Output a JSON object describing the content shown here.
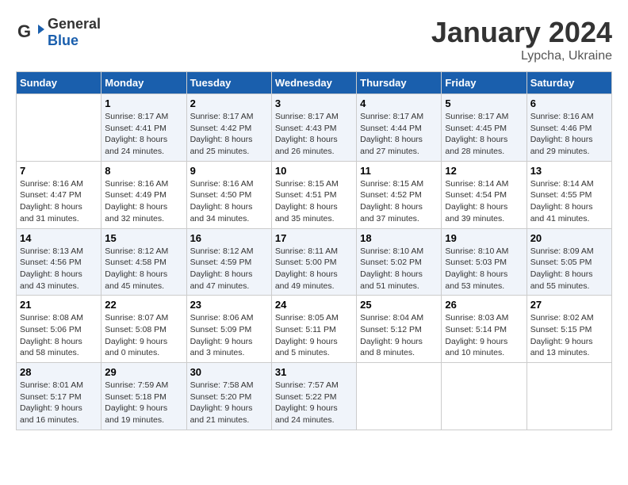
{
  "header": {
    "logo_general": "General",
    "logo_blue": "Blue",
    "month": "January 2024",
    "location": "Lypcha, Ukraine"
  },
  "days_of_week": [
    "Sunday",
    "Monday",
    "Tuesday",
    "Wednesday",
    "Thursday",
    "Friday",
    "Saturday"
  ],
  "weeks": [
    [
      {
        "day": "",
        "info": ""
      },
      {
        "day": "1",
        "info": "Sunrise: 8:17 AM\nSunset: 4:41 PM\nDaylight: 8 hours\nand 24 minutes."
      },
      {
        "day": "2",
        "info": "Sunrise: 8:17 AM\nSunset: 4:42 PM\nDaylight: 8 hours\nand 25 minutes."
      },
      {
        "day": "3",
        "info": "Sunrise: 8:17 AM\nSunset: 4:43 PM\nDaylight: 8 hours\nand 26 minutes."
      },
      {
        "day": "4",
        "info": "Sunrise: 8:17 AM\nSunset: 4:44 PM\nDaylight: 8 hours\nand 27 minutes."
      },
      {
        "day": "5",
        "info": "Sunrise: 8:17 AM\nSunset: 4:45 PM\nDaylight: 8 hours\nand 28 minutes."
      },
      {
        "day": "6",
        "info": "Sunrise: 8:16 AM\nSunset: 4:46 PM\nDaylight: 8 hours\nand 29 minutes."
      }
    ],
    [
      {
        "day": "7",
        "info": ""
      },
      {
        "day": "8",
        "info": "Sunrise: 8:16 AM\nSunset: 4:49 PM\nDaylight: 8 hours\nand 32 minutes."
      },
      {
        "day": "9",
        "info": "Sunrise: 8:16 AM\nSunset: 4:50 PM\nDaylight: 8 hours\nand 34 minutes."
      },
      {
        "day": "10",
        "info": "Sunrise: 8:15 AM\nSunset: 4:51 PM\nDaylight: 8 hours\nand 35 minutes."
      },
      {
        "day": "11",
        "info": "Sunrise: 8:15 AM\nSunset: 4:52 PM\nDaylight: 8 hours\nand 37 minutes."
      },
      {
        "day": "12",
        "info": "Sunrise: 8:14 AM\nSunset: 4:54 PM\nDaylight: 8 hours\nand 39 minutes."
      },
      {
        "day": "13",
        "info": "Sunrise: 8:14 AM\nSunset: 4:55 PM\nDaylight: 8 hours\nand 41 minutes."
      }
    ],
    [
      {
        "day": "14",
        "info": ""
      },
      {
        "day": "15",
        "info": "Sunrise: 8:12 AM\nSunset: 4:58 PM\nDaylight: 8 hours\nand 45 minutes."
      },
      {
        "day": "16",
        "info": "Sunrise: 8:12 AM\nSunset: 4:59 PM\nDaylight: 8 hours\nand 47 minutes."
      },
      {
        "day": "17",
        "info": "Sunrise: 8:11 AM\nSunset: 5:00 PM\nDaylight: 8 hours\nand 49 minutes."
      },
      {
        "day": "18",
        "info": "Sunrise: 8:10 AM\nSunset: 5:02 PM\nDaylight: 8 hours\nand 51 minutes."
      },
      {
        "day": "19",
        "info": "Sunrise: 8:10 AM\nSunset: 5:03 PM\nDaylight: 8 hours\nand 53 minutes."
      },
      {
        "day": "20",
        "info": "Sunrise: 8:09 AM\nSunset: 5:05 PM\nDaylight: 8 hours\nand 55 minutes."
      }
    ],
    [
      {
        "day": "21",
        "info": ""
      },
      {
        "day": "22",
        "info": "Sunrise: 8:07 AM\nSunset: 5:08 PM\nDaylight: 9 hours\nand 0 minutes."
      },
      {
        "day": "23",
        "info": "Sunrise: 8:06 AM\nSunset: 5:09 PM\nDaylight: 9 hours\nand 3 minutes."
      },
      {
        "day": "24",
        "info": "Sunrise: 8:05 AM\nSunset: 5:11 PM\nDaylight: 9 hours\nand 5 minutes."
      },
      {
        "day": "25",
        "info": "Sunrise: 8:04 AM\nSunset: 5:12 PM\nDaylight: 9 hours\nand 8 minutes."
      },
      {
        "day": "26",
        "info": "Sunrise: 8:03 AM\nSunset: 5:14 PM\nDaylight: 9 hours\nand 10 minutes."
      },
      {
        "day": "27",
        "info": "Sunrise: 8:02 AM\nSunset: 5:15 PM\nDaylight: 9 hours\nand 13 minutes."
      }
    ],
    [
      {
        "day": "28",
        "info": ""
      },
      {
        "day": "29",
        "info": "Sunrise: 7:59 AM\nSunset: 5:18 PM\nDaylight: 9 hours\nand 19 minutes."
      },
      {
        "day": "30",
        "info": "Sunrise: 7:58 AM\nSunset: 5:20 PM\nDaylight: 9 hours\nand 21 minutes."
      },
      {
        "day": "31",
        "info": "Sunrise: 7:57 AM\nSunset: 5:22 PM\nDaylight: 9 hours\nand 24 minutes."
      },
      {
        "day": "",
        "info": ""
      },
      {
        "day": "",
        "info": ""
      },
      {
        "day": "",
        "info": ""
      }
    ]
  ],
  "week0_day7_info": "Sunrise: 8:16 AM\nSunset: 4:47 PM\nDaylight: 8 hours\nand 31 minutes.",
  "week1_day0_info": "Sunrise: 8:16 AM\nSunset: 4:47 PM\nDaylight: 8 hours\nand 31 minutes.",
  "week2_day0_info": "Sunrise: 8:13 AM\nSunset: 4:56 PM\nDaylight: 8 hours\nand 43 minutes.",
  "week3_day0_info": "Sunrise: 8:08 AM\nSunset: 5:06 PM\nDaylight: 8 hours\nand 58 minutes.",
  "week4_day0_info": "Sunrise: 8:01 AM\nSunset: 5:17 PM\nDaylight: 9 hours\nand 16 minutes."
}
